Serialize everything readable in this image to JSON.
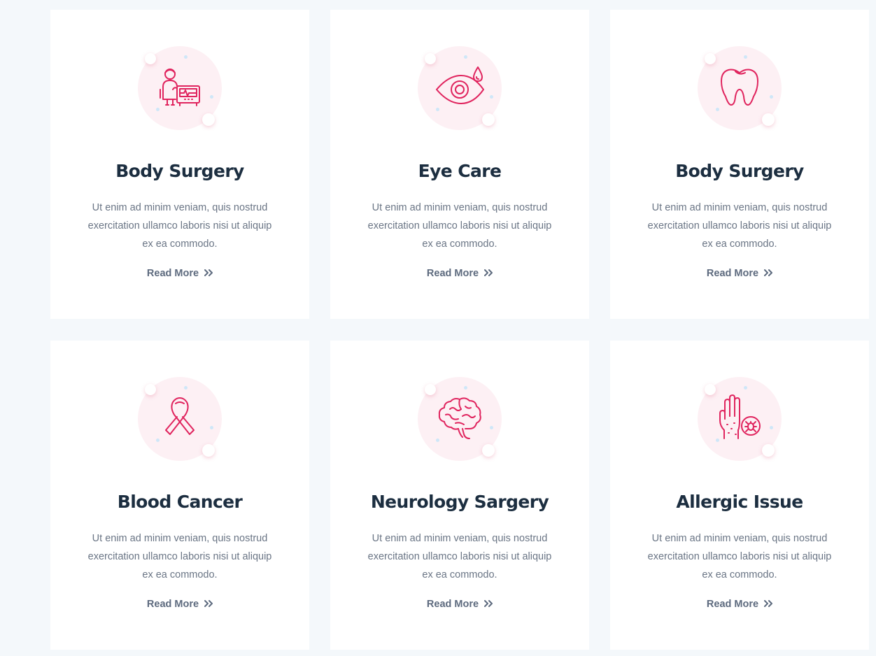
{
  "accent_color": "#e0245e",
  "services": [
    {
      "icon": "doctor-monitor-icon",
      "title": "Body Surgery",
      "description": "Ut enim ad minim veniam, quis nostrud exercitation ullamco laboris nisi ut aliquip ex ea commodo.",
      "link_label": "Read More"
    },
    {
      "icon": "eye-drop-icon",
      "title": "Eye Care",
      "description": "Ut enim ad minim veniam, quis nostrud exercitation ullamco laboris nisi ut aliquip ex ea commodo.",
      "link_label": "Read More"
    },
    {
      "icon": "tooth-icon",
      "title": "Body Surgery",
      "description": "Ut enim ad minim veniam, quis nostrud exercitation ullamco laboris nisi ut aliquip ex ea commodo.",
      "link_label": "Read More"
    },
    {
      "icon": "awareness-ribbon-icon",
      "title": "Blood Cancer",
      "description": "Ut enim ad minim veniam, quis nostrud exercitation ullamco laboris nisi ut aliquip ex ea commodo.",
      "link_label": "Read More"
    },
    {
      "icon": "brain-icon",
      "title": "Neurology Sargery",
      "description": "Ut enim ad minim veniam, quis nostrud exercitation ullamco laboris nisi ut aliquip ex ea commodo.",
      "link_label": "Read More"
    },
    {
      "icon": "hand-allergy-icon",
      "title": "Allergic Issue",
      "description": "Ut enim ad minim veniam, quis nostrud exercitation ullamco laboris nisi ut aliquip ex ea commodo.",
      "link_label": "Read More"
    }
  ]
}
